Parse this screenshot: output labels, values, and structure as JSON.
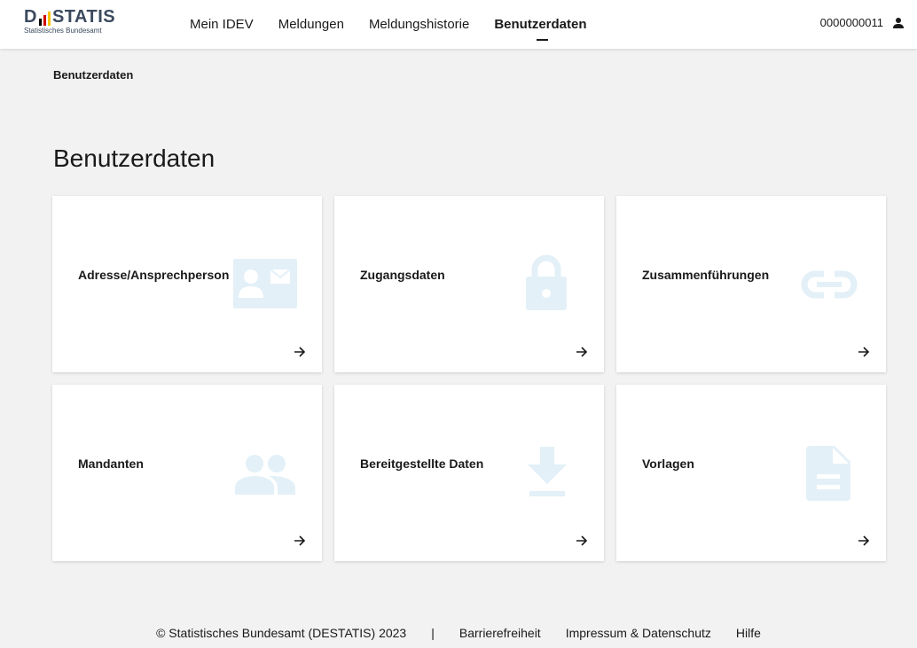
{
  "brand": {
    "name_left": "D",
    "name_right": "STATIS",
    "subtitle": "Statistisches Bundesamt",
    "bar_colors": [
      "#000000",
      "#d00000",
      "#f5c400"
    ]
  },
  "nav": {
    "items": [
      {
        "label": "Mein IDEV"
      },
      {
        "label": "Meldungen"
      },
      {
        "label": "Meldungshistorie"
      },
      {
        "label": "Benutzerdaten",
        "active": true
      }
    ]
  },
  "user": {
    "id": "0000000011",
    "icon": "user-icon"
  },
  "breadcrumb": "Benutzerdaten",
  "page_title": "Benutzerdaten",
  "cards": [
    {
      "label": "Adresse/Ansprechperson",
      "icon": "contact-card-icon"
    },
    {
      "label": "Zugangsdaten",
      "icon": "lock-icon"
    },
    {
      "label": "Zusammenführungen",
      "icon": "link-icon"
    },
    {
      "label": "Mandanten",
      "icon": "people-icon"
    },
    {
      "label": "Bereitgestellte Daten",
      "icon": "download-icon"
    },
    {
      "label": "Vorlagen",
      "icon": "document-icon"
    }
  ],
  "icon_color": "#e3f0f7",
  "footer": {
    "copyright": "© Statistisches Bundesamt (DESTATIS) 2023",
    "separator": "|",
    "links": [
      "Barrierefreiheit",
      "Impressum & Datenschutz",
      "Hilfe"
    ]
  }
}
